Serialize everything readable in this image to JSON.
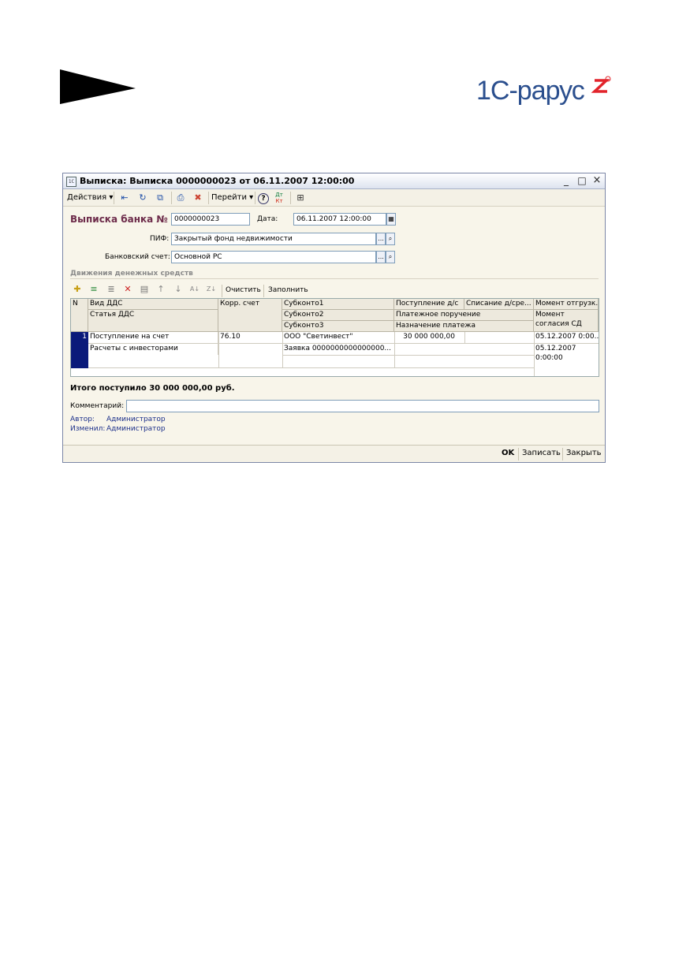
{
  "logo": {
    "text": "1С-рарус"
  },
  "window": {
    "title": "Выписка: Выписка 0000000023 от 06.11.2007 12:00:00",
    "controls": {
      "minimize": "_",
      "maximize": "□",
      "close": "×"
    }
  },
  "toolbar": {
    "actions_label": "Действия",
    "goto_label": "Перейти",
    "help_icon": "?",
    "dtkt_top": "Дт",
    "dtkt_bottom": "Кт"
  },
  "form": {
    "header_label": "Выписка банка №",
    "number_value": "0000000023",
    "date_label": "Дата:",
    "date_value": "06.11.2007 12:00:00",
    "pif_label": "ПИФ:",
    "pif_value": "Закрытый фонд недвижимости",
    "account_label": "Банковский счет:",
    "account_value": "Основной РС",
    "select_btn": "...",
    "search_btn": "🔍"
  },
  "movements": {
    "group_title": "Движения денежных средств",
    "clear_label": "Очистить",
    "fill_label": "Заполнить"
  },
  "table": {
    "headers": {
      "n": "N",
      "vid_dds": "Вид ДДС",
      "statya": "Статья ДДС",
      "korr": "Корр. счет",
      "sub1": "Субконто1",
      "sub2": "Субконто2",
      "sub3": "Субконто3",
      "postuplenie": "Поступление д/с",
      "spisanie": "Списание д/сре...",
      "platezh": "Платежное поручение",
      "naznachenie": "Назначение платежа",
      "moment_otgr": "Момент отгрузк...",
      "moment_sogl_1": "Момент",
      "moment_sogl_2": "согласия СД"
    },
    "rows": [
      {
        "n": "1",
        "vid_dds": "Поступление на счет",
        "statya": "Расчеты с инвесторами",
        "korr": "76.10",
        "sub1": "ООО \"Светинвест\"",
        "sub2": "Заявка 0000000000000000...",
        "sub3": "",
        "postuplenie": "30 000 000,00",
        "spisanie": "",
        "moment_otgr": "05.12.2007 0:00...",
        "moment_sogl_date": "05.12.2007",
        "moment_sogl_time": "0:00:00"
      }
    ]
  },
  "total_text": "Итого поступило 30 000 000,00 руб.",
  "comment_label": "Комментарий:",
  "comment_value": "",
  "author_label": "Автор:",
  "author_value": "Администратор",
  "changed_label": "Изменил:",
  "changed_value": "Администратор",
  "buttons": {
    "ok": "OK",
    "save": "Записать",
    "close": "Закрыть"
  },
  "colors": {
    "accent_header": "#6d2b4a",
    "link": "#1b2f8a",
    "row_marker": "#0a1a7a"
  }
}
